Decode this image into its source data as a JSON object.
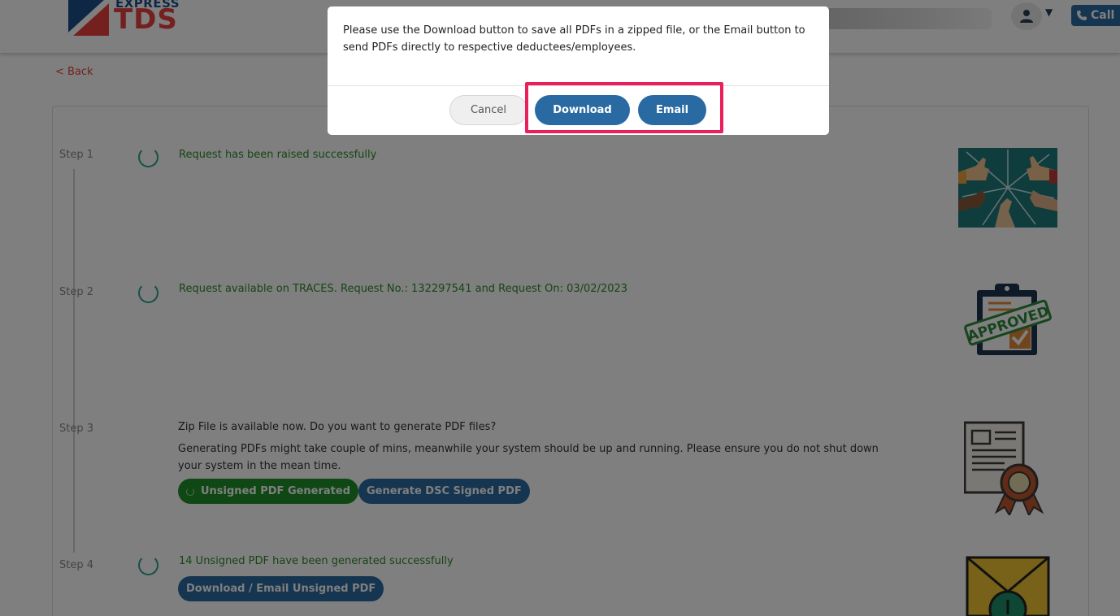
{
  "header": {
    "logo_express": "EXPRESS",
    "logo_tds": "TDS",
    "call_label": "Call"
  },
  "nav": {
    "back_label": "< Back"
  },
  "steps": [
    {
      "label": "Step 1",
      "text": "Request has been raised successfully",
      "image": "thumbs-up-hands-image"
    },
    {
      "label": "Step 2",
      "text": "Request available on TRACES. Request No.: 132297541 and Request On: 03/02/2023",
      "image": "approved-clipboard-image",
      "image_text": "APPROVED"
    },
    {
      "label": "Step 3",
      "title": "Zip File is available now. Do you want to generate PDF files?",
      "text": "Generating PDFs might take couple of mins, meanwhile your system should be up and running. Please ensure you do not shut down your system in the mean time.",
      "btn_unsigned": "Unsigned PDF Generated",
      "btn_dsc": "Generate DSC Signed PDF",
      "image": "certificate-ribbon-image"
    },
    {
      "label": "Step 4",
      "text": "14 Unsigned PDF have been generated successfully",
      "btn_download_email": "Download / Email Unsigned PDF",
      "image": "envelope-download-image"
    }
  ],
  "modal": {
    "message": "Please use the Download button to save all PDFs in a zipped file, or the Email button to send PDFs directly to respective deductees/employees.",
    "cancel_label": "Cancel",
    "download_label": "Download",
    "email_label": "Email"
  },
  "colors": {
    "brand_blue": "#2a6aa3",
    "brand_red": "#e8403c",
    "success_green": "#2c8a2c",
    "highlight": "#ea1f5c"
  }
}
